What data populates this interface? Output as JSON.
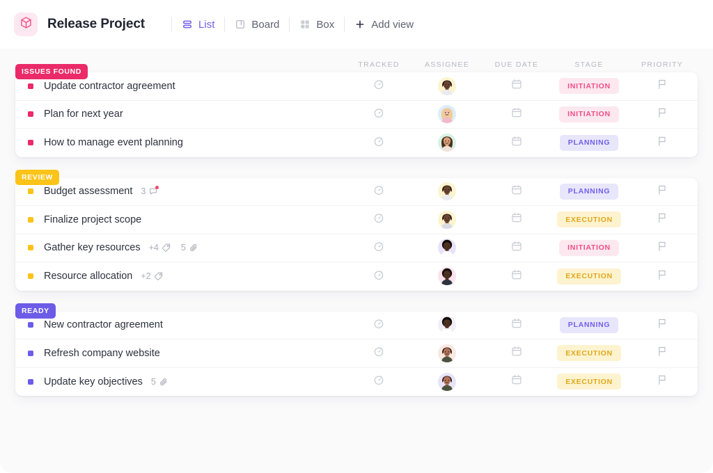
{
  "header": {
    "logo_icon": "cube-icon",
    "logo_color": "#ef4d87",
    "logo_bg": "#fde7f0",
    "title": "Release Project",
    "views": [
      {
        "label": "List",
        "icon": "list-icon",
        "active": true
      },
      {
        "label": "Board",
        "icon": "board-icon",
        "active": false
      },
      {
        "label": "Box",
        "icon": "box-icon",
        "active": false
      },
      {
        "label": "Add view",
        "icon": "plus-icon",
        "active": false
      }
    ]
  },
  "columns": [
    {
      "key": "tracked",
      "label": "TRACKED"
    },
    {
      "key": "assignee",
      "label": "ASSIGNEE"
    },
    {
      "key": "due_date",
      "label": "DUE DATE"
    },
    {
      "key": "stage",
      "label": "STAGE"
    },
    {
      "key": "priority",
      "label": "PRIORITY"
    }
  ],
  "colors": {
    "accent_purple": "#7060e8",
    "issues_found": "#ea2a69",
    "review": "#fcc318",
    "ready": "#6c5ce7",
    "stage_initiation_bg": "#fde8ef",
    "stage_initiation_fg": "#ef4d87",
    "stage_planning_bg": "#e8e6fb",
    "stage_planning_fg": "#7060e8",
    "stage_execution_bg": "#fdf3cf",
    "stage_execution_fg": "#e0a81a",
    "page_bg": "#fafafb"
  },
  "groups": [
    {
      "name": "ISSUES FOUND",
      "badge_color": "#ea2a69",
      "dot_color": "#ea2a69",
      "tasks": [
        {
          "name": "Update contractor agreement",
          "tracked_icon": "stopwatch-icon",
          "avatar": {
            "name": "avatar-bearded-man",
            "halo": "#fdf4cf",
            "skin": "#6b4430",
            "hair": "#1c1410",
            "shirt": "#e9ebef"
          },
          "due_icon": "calendar-icon",
          "stage": "INITIATION",
          "priority_icon": "flag-icon",
          "meta": []
        },
        {
          "name": "Plan for next year",
          "tracked_icon": "stopwatch-icon",
          "avatar": {
            "name": "avatar-blonde-woman",
            "halo": "#dcecfb",
            "skin": "#f0c4a8",
            "hair": "#f0cf8e",
            "shirt": "#f3b9c8"
          },
          "due_icon": "calendar-icon",
          "stage": "INITIATION",
          "priority_icon": "flag-icon",
          "meta": []
        },
        {
          "name": "How to manage event planning",
          "tracked_icon": "stopwatch-icon",
          "avatar": {
            "name": "avatar-smiling-woman",
            "halo": "#d9f2e3",
            "skin": "#d9a07a",
            "hair": "#47301f",
            "shirt": "#f0e3d8"
          },
          "due_icon": "calendar-icon",
          "stage": "PLANNING",
          "priority_icon": "flag-icon",
          "meta": []
        }
      ]
    },
    {
      "name": "REVIEW",
      "badge_color": "#fcc318",
      "dot_color": "#fcc318",
      "tasks": [
        {
          "name": "Budget assessment",
          "tracked_icon": "stopwatch-icon",
          "avatar": {
            "name": "avatar-bearded-man",
            "halo": "#fdf4cf",
            "skin": "#6b4430",
            "hair": "#1c1410",
            "shirt": "#e9ebef"
          },
          "due_icon": "calendar-icon",
          "stage": "PLANNING",
          "priority_icon": "flag-icon",
          "meta": [
            {
              "count": "3",
              "icon": "comment-icon",
              "badge": true
            }
          ]
        },
        {
          "name": "Finalize project scope",
          "tracked_icon": "stopwatch-icon",
          "avatar": {
            "name": "avatar-bearded-man",
            "halo": "#fdf4cf",
            "skin": "#6b4430",
            "hair": "#1c1410",
            "shirt": "#d8dbe2"
          },
          "due_icon": "calendar-icon",
          "stage": "EXECUTION",
          "priority_icon": "flag-icon",
          "meta": []
        },
        {
          "name": "Gather key resources",
          "tracked_icon": "stopwatch-icon",
          "avatar": {
            "name": "avatar-afro-man",
            "halo": "#e6e3fa",
            "skin": "#4e3222",
            "hair": "#120c08",
            "shirt": "#ffffff"
          },
          "due_icon": "calendar-icon",
          "stage": "INITIATION",
          "priority_icon": "flag-icon",
          "meta": [
            {
              "count": "+4",
              "icon": "tag-icon",
              "badge": false
            },
            {
              "count": "5",
              "icon": "paperclip-icon",
              "badge": false
            }
          ]
        },
        {
          "name": "Resource allocation",
          "tracked_icon": "stopwatch-icon",
          "avatar": {
            "name": "avatar-afro-man",
            "halo": "#fbe2ec",
            "skin": "#4e3222",
            "hair": "#120c08",
            "shirt": "#2f3340"
          },
          "due_icon": "calendar-icon",
          "stage": "EXECUTION",
          "priority_icon": "flag-icon",
          "meta": [
            {
              "count": "+2",
              "icon": "tag-icon",
              "badge": false
            }
          ]
        }
      ]
    },
    {
      "name": "READY",
      "badge_color": "#6c5ce7",
      "dot_color": "#6c5ce7",
      "tasks": [
        {
          "name": "New contractor agreement",
          "tracked_icon": "stopwatch-icon",
          "avatar": {
            "name": "avatar-afro-man",
            "halo": "#f1eff6",
            "skin": "#4e3222",
            "hair": "#120c08",
            "shirt": "#ffffff"
          },
          "due_icon": "calendar-icon",
          "stage": "PLANNING",
          "priority_icon": "flag-icon",
          "meta": []
        },
        {
          "name": "Refresh company website",
          "tracked_icon": "stopwatch-icon",
          "avatar": {
            "name": "avatar-short-hair-man",
            "halo": "#fbe8e0",
            "skin": "#b3735a",
            "hair": "#241a14",
            "shirt": "#4d5240"
          },
          "due_icon": "calendar-icon",
          "stage": "EXECUTION",
          "priority_icon": "flag-icon",
          "meta": []
        },
        {
          "name": "Update key objectives",
          "tracked_icon": "stopwatch-icon",
          "avatar": {
            "name": "avatar-short-hair-man",
            "halo": "#e8e4f7",
            "skin": "#b3735a",
            "hair": "#241a14",
            "shirt": "#4d5240"
          },
          "due_icon": "calendar-icon",
          "stage": "EXECUTION",
          "priority_icon": "flag-icon",
          "meta": [
            {
              "count": "5",
              "icon": "paperclip-icon",
              "badge": false
            }
          ]
        }
      ]
    }
  ]
}
